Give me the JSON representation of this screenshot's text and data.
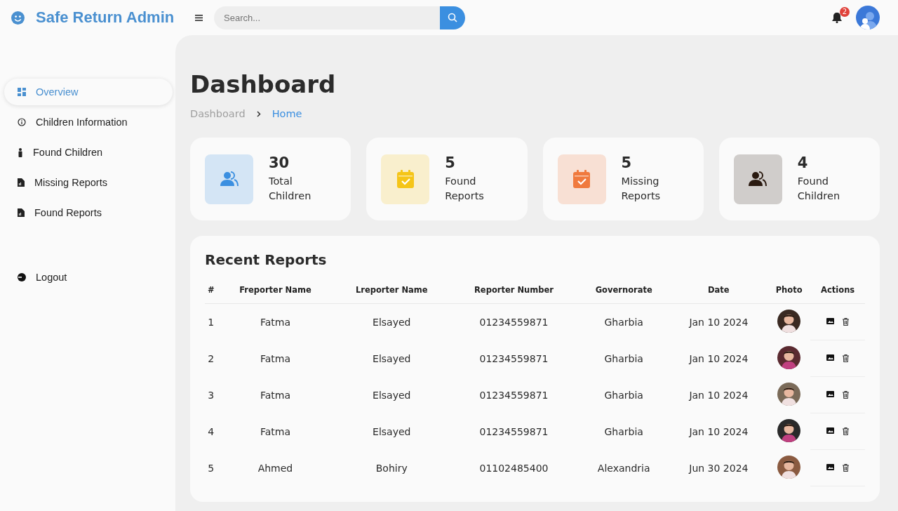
{
  "brand": {
    "title": "Safe Return Admin"
  },
  "search": {
    "placeholder": "Search..."
  },
  "notifications": {
    "count": "2"
  },
  "sidebar": {
    "items": [
      {
        "label": "Overview",
        "kind": "grid",
        "selected": true
      },
      {
        "label": "Children Information",
        "kind": "info",
        "selected": false
      },
      {
        "label": "Found Children",
        "kind": "person",
        "selected": false
      },
      {
        "label": "Missing Reports",
        "kind": "file",
        "selected": false
      },
      {
        "label": "Found Reports",
        "kind": "file",
        "selected": false
      }
    ],
    "logout": "Logout"
  },
  "page": {
    "title": "Dashboard",
    "breadcrumb": [
      {
        "label": "Dashboard",
        "selected": false
      },
      {
        "label": "Home",
        "selected": true
      }
    ]
  },
  "stats": [
    {
      "value": "30",
      "label": "Total Children",
      "kind": "users",
      "color": "#3b8fe0"
    },
    {
      "value": "5",
      "label": "Found Reports",
      "kind": "calendar",
      "color": "#f5c518"
    },
    {
      "value": "5",
      "label": "Missing Reports",
      "kind": "calendar",
      "color": "#f07a3e"
    },
    {
      "value": "4",
      "label": "Found Children",
      "kind": "users",
      "color": "#2a1a10"
    }
  ],
  "table": {
    "title": "Recent Reports",
    "columns": [
      "#",
      "Freporter Name",
      "Lreporter Name",
      "Reporter Number",
      "Governorate",
      "Date",
      "Photo",
      "Actions"
    ],
    "rows": [
      {
        "cells": [
          "1",
          "Fatma",
          "Elsayed",
          "01234559871",
          "Gharbia",
          "Jan 10 2024"
        ]
      },
      {
        "cells": [
          "2",
          "Fatma",
          "Elsayed",
          "01234559871",
          "Gharbia",
          "Jan 10 2024"
        ]
      },
      {
        "cells": [
          "3",
          "Fatma",
          "Elsayed",
          "01234559871",
          "Gharbia",
          "Jan 10 2024"
        ]
      },
      {
        "cells": [
          "4",
          "Fatma",
          "Elsayed",
          "01234559871",
          "Gharbia",
          "Jan 10 2024"
        ]
      },
      {
        "cells": [
          "5",
          "Ahmed",
          "Bohiry",
          "01102485400",
          "Alexandria",
          "Jun 30 2024"
        ]
      }
    ]
  }
}
